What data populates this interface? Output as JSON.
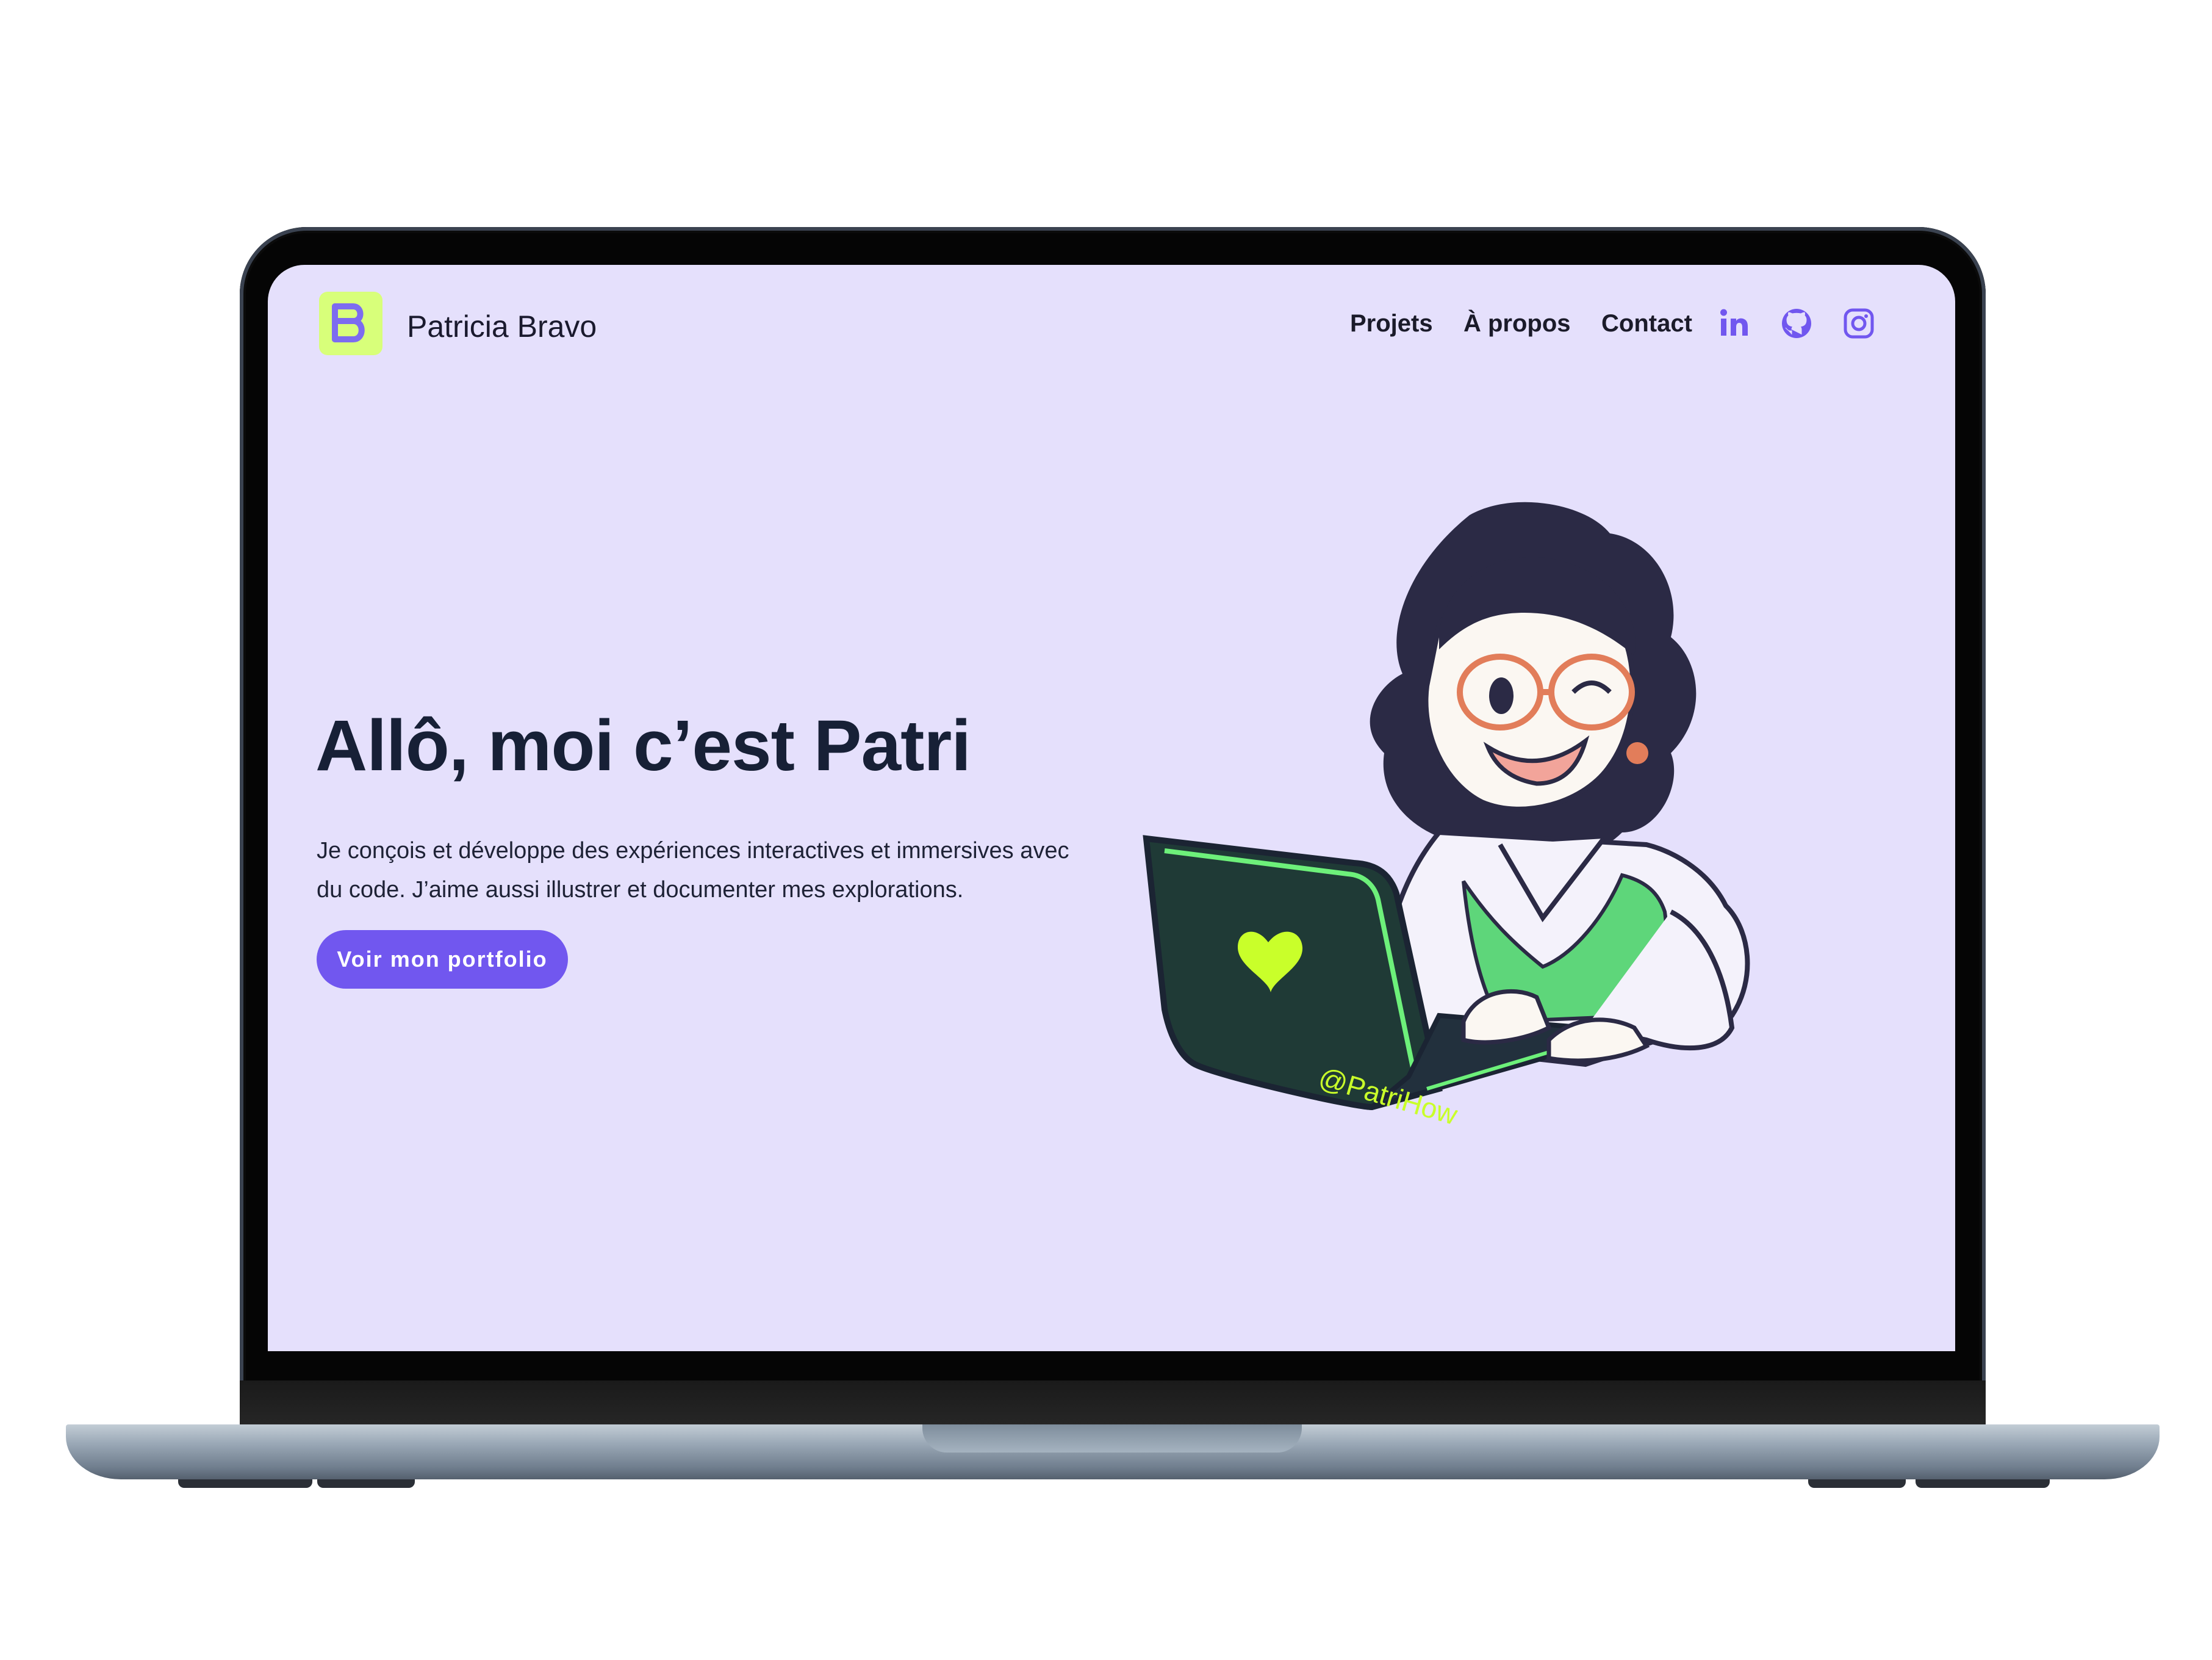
{
  "header": {
    "brand": "Patricia Bravo",
    "nav": [
      "Projets",
      "À propos",
      "Contact"
    ],
    "social": [
      "linkedin-icon",
      "github-icon",
      "instagram-icon"
    ]
  },
  "hero": {
    "title": "Allô, moi c’est Patri",
    "description": "Je conçois et développe des expériences interactives et immersives avec du code. J’aime aussi illustrer et documenter mes explorations.",
    "cta": "Voir mon portfolio"
  },
  "illustration": {
    "signature": "@PatriHow"
  },
  "colors": {
    "background": "#e5e0fc",
    "accent": "#7157ef",
    "logo_bg": "#d8ff7a",
    "title": "#172036"
  }
}
